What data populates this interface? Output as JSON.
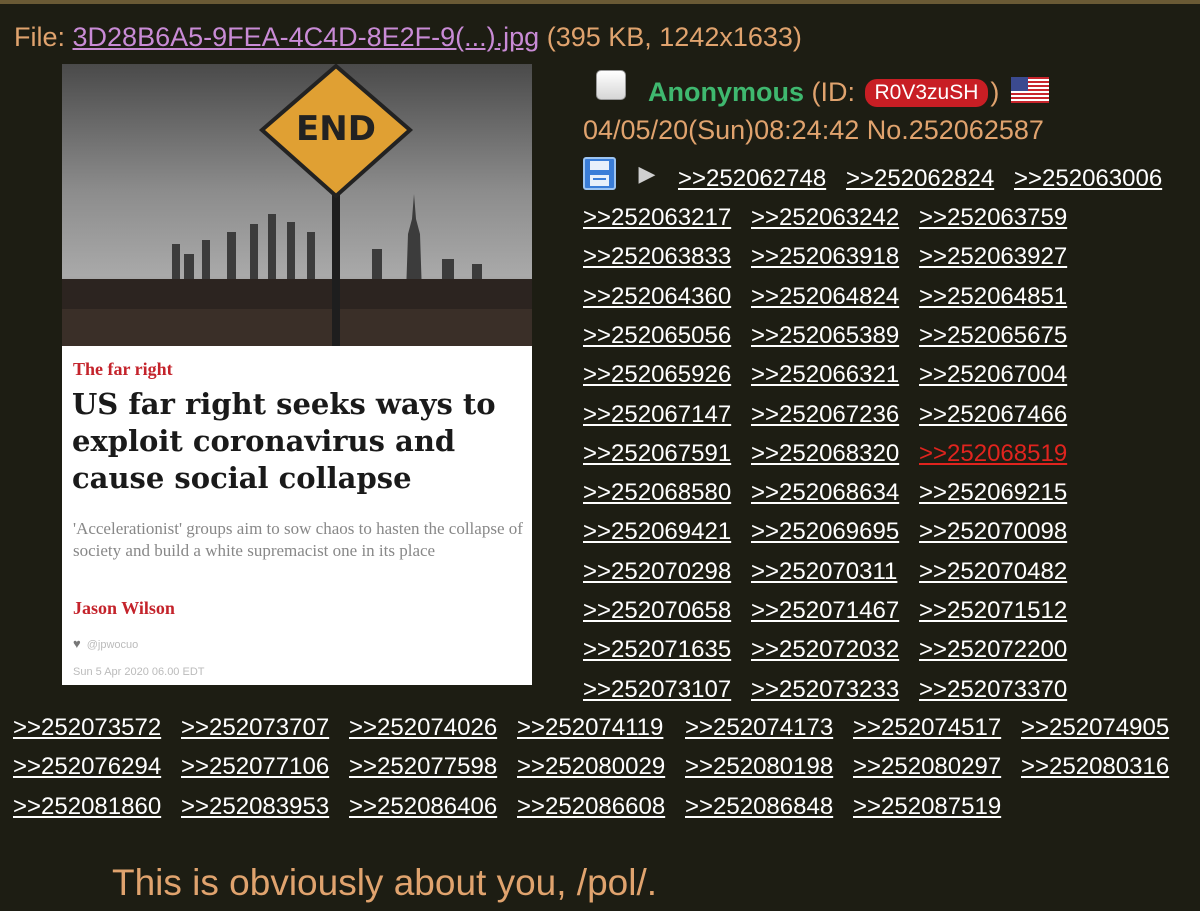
{
  "file": {
    "prefix": "File: ",
    "name": "3D28B6A5-9FEA-4C4D-8E2F-9(...).jpg",
    "meta": " (395 KB, 1242x1633)"
  },
  "thumbnail": {
    "sign_text": "END",
    "kicker": "The far right",
    "headline": "US far right seeks ways to exploit coronavirus and cause social collapse",
    "standfirst": "'Accelerationist' groups aim to sow chaos to hasten the collapse of society and build a white supremacist one in its place",
    "byline": "Jason Wilson",
    "handle": "@jpwocuo",
    "date": "Sun 5 Apr 2020 06.00 EDT"
  },
  "post": {
    "name": "Anonymous",
    "id_prefix": " (ID: ",
    "id": "R0V3zuSH",
    "id_suffix": ")",
    "datetime": "04/05/20(Sun)08:24:42 No.252062587"
  },
  "replies": [
    ">>252062748",
    ">>252062824",
    ">>252063006",
    ">>252063217",
    ">>252063242",
    ">>252063759",
    ">>252063833",
    ">>252063918",
    ">>252063927",
    ">>252064360",
    ">>252064824",
    ">>252064851",
    ">>252065056",
    ">>252065389",
    ">>252065675",
    ">>252065926",
    ">>252066321",
    ">>252067004",
    ">>252067147",
    ">>252067236",
    ">>252067466",
    ">>252067591",
    ">>252068320",
    ">>252068519",
    ">>252068580",
    ">>252068634",
    ">>252069215",
    ">>252069421",
    ">>252069695",
    ">>252070098",
    ">>252070298",
    ">>252070311",
    ">>252070482",
    ">>252070658",
    ">>252071467",
    ">>252071512",
    ">>252071635",
    ">>252072032",
    ">>252072200",
    ">>252073107",
    ">>252073233",
    ">>252073370",
    ">>252073572",
    ">>252073707",
    ">>252074026",
    ">>252074119",
    ">>252074173",
    ">>252074517",
    ">>252074905",
    ">>252076294",
    ">>252077106",
    ">>252077598",
    ">>252080029",
    ">>252080198",
    ">>252080297",
    ">>252080316",
    ">>252081860",
    ">>252083953",
    ">>252086406",
    ">>252086608",
    ">>252086848",
    ">>252087519"
  ],
  "dead_reply_index": 23,
  "colors": {
    "background": "#1d1d13",
    "text": "#e0a36e",
    "name": "#3fb86f",
    "file_link": "#c98bd6",
    "dead_link": "#e0241e",
    "id_badge": "#c81e24"
  },
  "icons": {
    "checkbox": "checkbox-icon",
    "flag": "us-flag-icon",
    "save": "floppy-save-icon",
    "play": "play-triangle-icon"
  },
  "comment": "This is obviously about you, /pol/."
}
